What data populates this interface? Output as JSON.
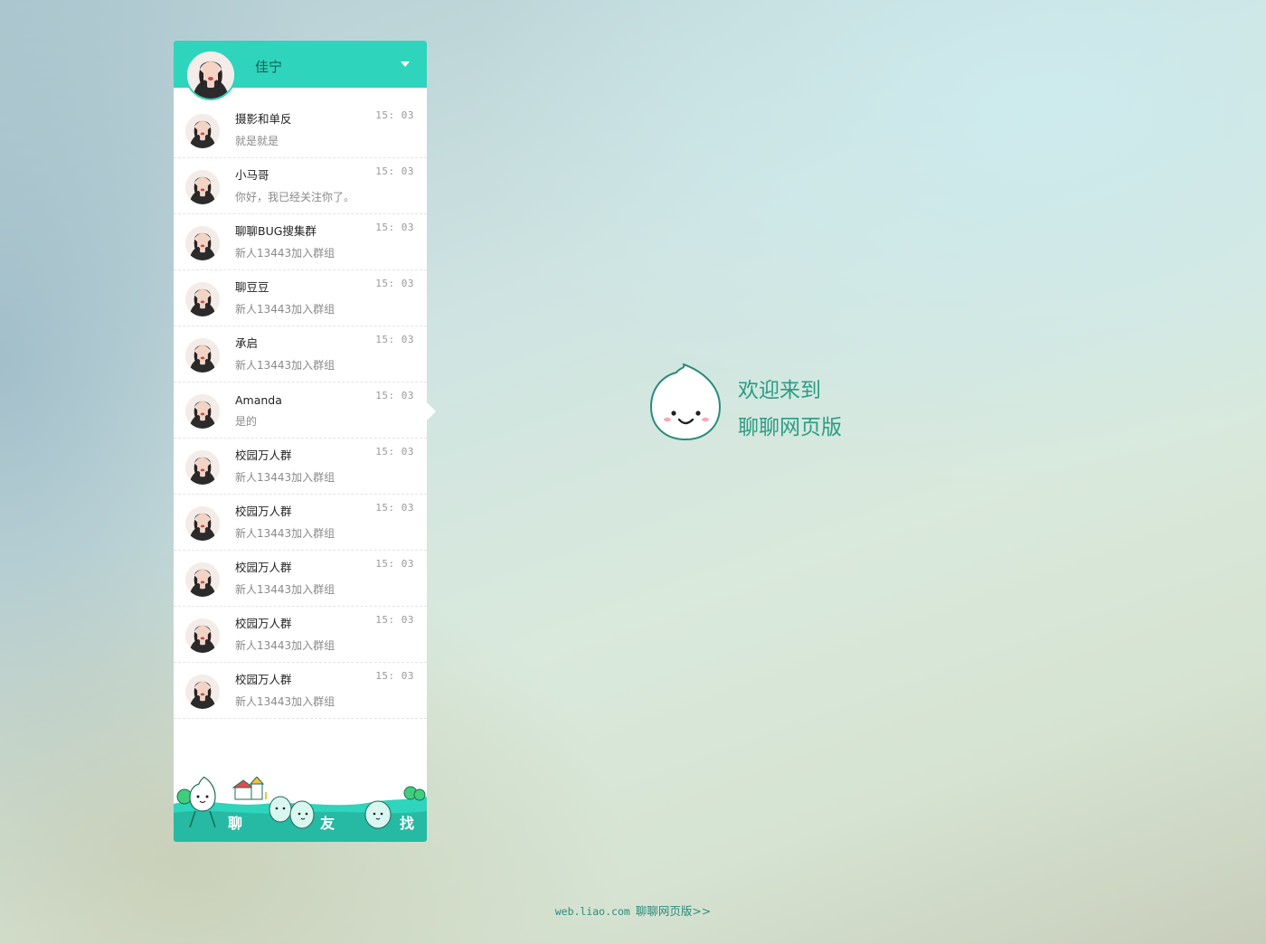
{
  "header": {
    "user_name": "佳宁"
  },
  "chats": [
    {
      "name": "摄影和单反",
      "preview": "就是就是",
      "time": "15: 03"
    },
    {
      "name": "小马哥",
      "preview": "你好，我已经关注你了。",
      "time": "15: 03"
    },
    {
      "name": "聊聊BUG搜集群",
      "preview": "新人13443加入群组",
      "time": "15: 03"
    },
    {
      "name": "聊豆豆",
      "preview": "新人13443加入群组",
      "time": "15: 03"
    },
    {
      "name": "承启",
      "preview": "新人13443加入群组",
      "time": "15: 03"
    },
    {
      "name": "Amanda",
      "preview": "是的",
      "time": "15: 03"
    },
    {
      "name": "校园万人群",
      "preview": "新人13443加入群组",
      "time": "15: 03"
    },
    {
      "name": "校园万人群",
      "preview": "新人13443加入群组",
      "time": "15: 03"
    },
    {
      "name": "校园万人群",
      "preview": "新人13443加入群组",
      "time": "15: 03"
    },
    {
      "name": "校园万人群",
      "preview": "新人13443加入群组",
      "time": "15: 03"
    },
    {
      "name": "校园万人群",
      "preview": "新人13443加入群组",
      "time": "15: 03"
    }
  ],
  "active_chat_index": 5,
  "nav": {
    "chat": "聊",
    "friends": "友",
    "find": "找"
  },
  "welcome": {
    "line1": "欢迎来到",
    "line2": "聊聊网页版"
  },
  "footer": {
    "domain": "web.liao.com",
    "link": "聊聊网页版>>"
  },
  "colors": {
    "accent": "#2fd4bc",
    "welcome_text": "#2a9d84",
    "footer_text": "#2a8c7c"
  },
  "icons": {
    "dropdown": "caret-down-icon",
    "mascot": "droplet-mascot-icon"
  }
}
